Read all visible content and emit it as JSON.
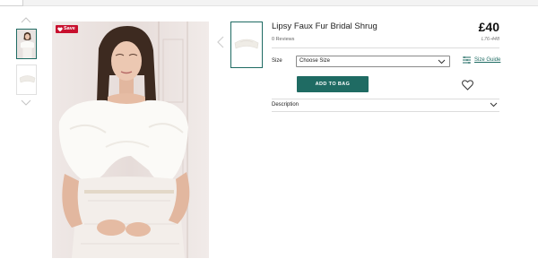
{
  "gallery": {
    "badge_label": "Save"
  },
  "product": {
    "title": "Lipsy Faux Fur Bridal Shrug",
    "reviews": "0 Reviews",
    "price": "£40",
    "sku": "L76-448"
  },
  "size": {
    "label": "Size",
    "selected": "Choose Size",
    "guide_label": "Size Guide"
  },
  "actions": {
    "add_to_bag": "ADD TO BAG"
  },
  "description": {
    "label": "Description"
  },
  "colors": {
    "accent": "#1f6b63",
    "badge": "#c8102e"
  }
}
